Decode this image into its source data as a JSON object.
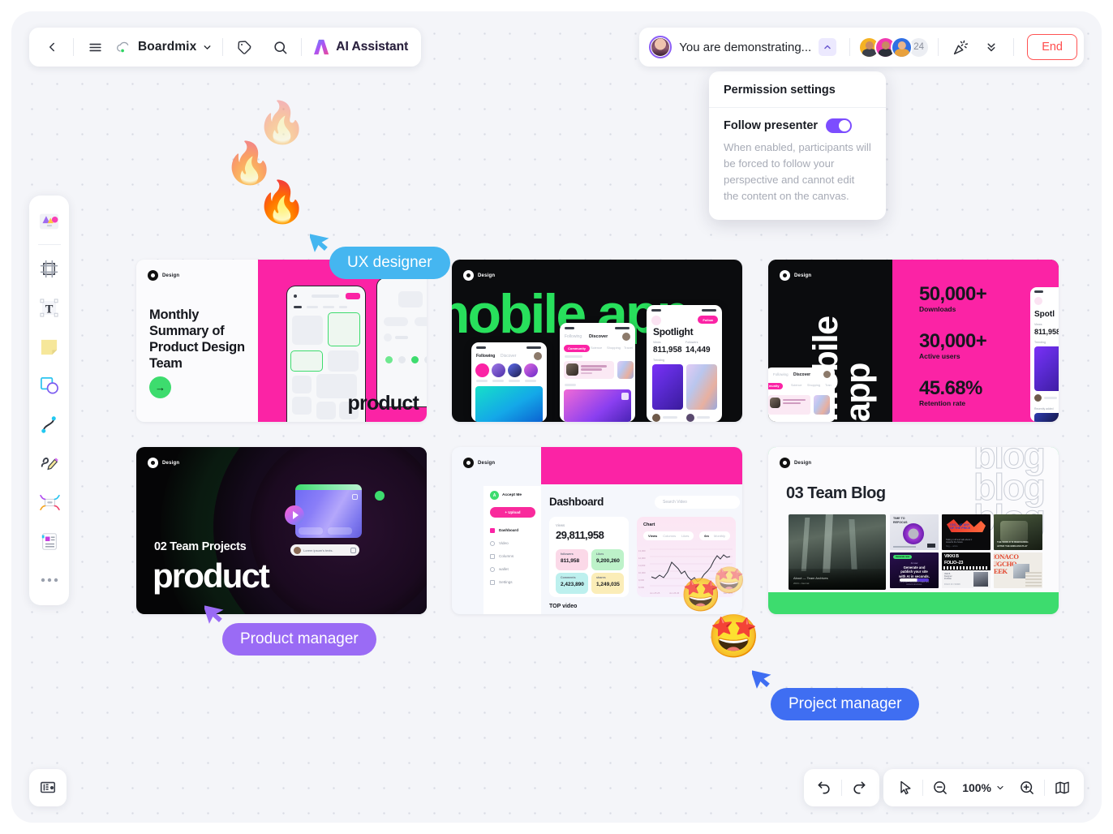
{
  "topbar": {
    "back_icon": "chevron-left-icon",
    "menu_icon": "hamburger-menu-icon",
    "brand": "Boardmix",
    "brand_icon": "cloud-icon",
    "brand_caret": "chevron-down-icon",
    "tag_icon": "tag-icon",
    "search_icon": "search-icon",
    "ai_label": "AI Assistant",
    "ai_icon": "ai-sparkle-icon"
  },
  "presentbar": {
    "status_text": "You are demonstrating...",
    "caret_icon": "chevron-up-icon",
    "presenter_avatar": "presenter-avatar",
    "participants": [
      "avatar-1",
      "avatar-2",
      "avatar-3"
    ],
    "extra_count": "24",
    "celebrate_icon": "party-popper-icon",
    "collapse_icon": "double-chevron-down-icon",
    "end_label": "End",
    "end_color": "#ff4d4d"
  },
  "permission_popover": {
    "title": "Permission settings",
    "toggle_label": "Follow presenter",
    "toggle_on": true,
    "toggle_color": "#7c4dff",
    "description": "When enabled, participants will be forced to follow your perspective and cannot edit the content on the canvas."
  },
  "rail": {
    "items": [
      {
        "name": "templates-icon",
        "label": "Templates"
      },
      {
        "name": "frame-icon",
        "label": "Frame"
      },
      {
        "name": "text-icon",
        "label": "Text"
      },
      {
        "name": "sticky-note-icon",
        "label": "Sticky note"
      },
      {
        "name": "shapes-icon",
        "label": "Shapes"
      },
      {
        "name": "connector-icon",
        "label": "Connector"
      },
      {
        "name": "pen-icon",
        "label": "Pen"
      },
      {
        "name": "mindmap-icon",
        "label": "Mind map"
      },
      {
        "name": "document-icon",
        "label": "Document"
      },
      {
        "name": "more-icon",
        "label": "More"
      }
    ]
  },
  "bottom_left": {
    "icon": "presentation-board-icon"
  },
  "bottom_right": {
    "undo_icon": "undo-icon",
    "redo_icon": "redo-icon",
    "pointer_icon": "cursor-pointer-icon",
    "zoom_out_icon": "zoom-out-icon",
    "zoom_level": "100%",
    "zoom_caret_icon": "chevron-down-icon",
    "zoom_in_icon": "zoom-in-icon",
    "minimap_icon": "minimap-icon"
  },
  "cursors": [
    {
      "label": "UX designer",
      "color": "#45b6f0"
    },
    {
      "label": "Product manager",
      "color": "#9a6bf5"
    },
    {
      "label": "Project manager",
      "color": "#3f6ef2"
    }
  ],
  "emojis": [
    {
      "name": "fire-emoji",
      "glyph": "🔥"
    },
    {
      "name": "star-struck-emoji",
      "glyph": "🤩"
    }
  ],
  "cards": [
    {
      "id": "card-monthly-summary",
      "badge": "Design",
      "title": "Monthly Summary of Product Design Team",
      "accent_word": "product",
      "accent_color": "#fb23a5",
      "arrow": "→"
    },
    {
      "id": "card-mobile-app",
      "badge": "Design",
      "headline": "mobile app",
      "headline_color": "#28e05c",
      "phone": {
        "spotlight": "Spotlight",
        "stat1_label": "Views",
        "stat1_value": "811,958",
        "stat2_label": "Followers",
        "stat2_value": "14,449",
        "trending": "Trending",
        "tabs": [
          "Following",
          "Discover"
        ],
        "chips": [
          "Community",
          "Science",
          "Shopping",
          "Travel"
        ],
        "follow": "Follow"
      }
    },
    {
      "id": "card-mobile-app-stats",
      "badge": "Design",
      "vertical_text": "mobile app",
      "stats": [
        {
          "value": "50,000+",
          "label": "Downloads"
        },
        {
          "value": "30,000+",
          "label": "Active users"
        },
        {
          "value": "45.68%",
          "label": "Retention rate"
        }
      ]
    },
    {
      "id": "card-team-projects",
      "badge": "Design",
      "kicker": "02 Team Projects",
      "headline": "product",
      "comment": "Lorem ipsum's texts."
    },
    {
      "id": "card-dashboard",
      "badge": "Design",
      "brand": "Accept Me",
      "upload_label": "+ Upload",
      "nav": [
        "Dashboard",
        "Video",
        "Columns",
        "wallet",
        "Settings"
      ],
      "title": "Dashboard",
      "search_placeholder": "Search Video",
      "views_label": "Views",
      "views_value": "29,811,958",
      "stats": [
        {
          "label": "followers",
          "value": "811,958"
        },
        {
          "label": "Likes",
          "value": "9,200,260"
        },
        {
          "label": "Comments",
          "value": "2,423,890"
        },
        {
          "label": "shares",
          "value": "1,249,035"
        }
      ],
      "chart_title": "Chart",
      "chart_tabs": [
        "Views",
        "Columns",
        "Likes"
      ],
      "chart_range": [
        "6m",
        "Monthly"
      ],
      "top_video": "TOP video"
    },
    {
      "id": "card-team-blog",
      "badge": "Design",
      "title": "03 Team Blog",
      "outline_word": "blog",
      "hero_caption": "About — Team Archives",
      "thumbs": [
        "TIME TO REFOCUS",
        "I DO... AT ANY PRICE",
        "THE WORLD IS REBUILDING",
        "Generate and publish your site with AI in seconds.",
        "VIKKI B FOLIO-23",
        "MONACO UGCHO WEEK"
      ]
    }
  ]
}
